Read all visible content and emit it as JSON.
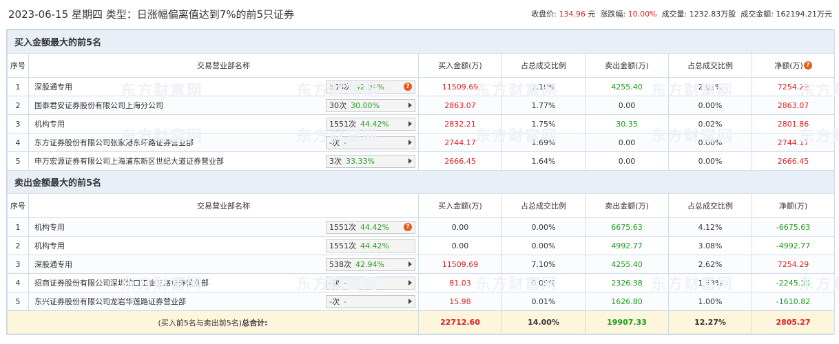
{
  "header": {
    "title": "2023-06-15 星期四 类型：日涨幅偏离值达到7%的前5只证券",
    "close_label": "收盘价:",
    "close_value": "134.96",
    "close_unit": "元",
    "change_label": "涨跌幅:",
    "change_value": "10.00%",
    "volume_label": "成交量:",
    "volume_value": "1232.83万股",
    "amount_label": "成交金额:",
    "amount_value": "162194.21万元"
  },
  "columns": {
    "idx": "序号",
    "name": "交易营业部名称",
    "buy": "买入金额(万)",
    "buy_ratio": "占总成交比例",
    "sell": "卖出金额(万)",
    "sell_ratio": "占总成交比例",
    "net": "净额(万)"
  },
  "buy_section": {
    "title": "买入金额最大的前5名",
    "rows": [
      {
        "idx": "1",
        "name": "深股通专用",
        "count": "538次",
        "pct": "42.94%",
        "icon": "question-icon",
        "buy": "11509.69",
        "buy_ratio": "7.10%",
        "sell": "4255.40",
        "sell_ratio": "2.62%",
        "net": "7254.29"
      },
      {
        "idx": "2",
        "name": "国泰君安证券股份有限公司上海分公司",
        "count": "30次",
        "pct": "30.00%",
        "icon": "arrow-right-icon",
        "buy": "2863.07",
        "buy_ratio": "1.77%",
        "sell": "0.00",
        "sell_ratio": "0.00%",
        "net": "2863.07"
      },
      {
        "idx": "3",
        "name": "机构专用",
        "count": "1551次",
        "pct": "44.42%",
        "icon": "arrow-right-icon",
        "buy": "2832.21",
        "buy_ratio": "1.75%",
        "sell": "30.35",
        "sell_ratio": "0.02%",
        "net": "2801.86"
      },
      {
        "idx": "4",
        "name": "东方证券股份有限公司张家港东环路证券营业部",
        "count": "-次",
        "pct": "-",
        "icon": "arrow-right-icon",
        "buy": "2744.17",
        "buy_ratio": "1.69%",
        "sell": "0.00",
        "sell_ratio": "0.00%",
        "net": "2744.17"
      },
      {
        "idx": "5",
        "name": "申万宏源证券有限公司上海浦东新区世纪大道证券营业部",
        "count": "3次",
        "pct": "33.33%",
        "icon": "arrow-right-icon",
        "buy": "2666.45",
        "buy_ratio": "1.64%",
        "sell": "0.00",
        "sell_ratio": "0.00%",
        "net": "2666.45"
      }
    ]
  },
  "sell_section": {
    "title": "卖出金额最大的前5名",
    "rows": [
      {
        "idx": "1",
        "name": "机构专用",
        "count": "1551次",
        "pct": "44.42%",
        "icon": "question-icon",
        "buy": "0.00",
        "buy_ratio": "0.00%",
        "sell": "6675.63",
        "sell_ratio": "4.12%",
        "net": "-6675.63"
      },
      {
        "idx": "2",
        "name": "机构专用",
        "count": "1551次",
        "pct": "44.42%",
        "icon": "none",
        "buy": "0.00",
        "buy_ratio": "0.00%",
        "sell": "4992.77",
        "sell_ratio": "3.08%",
        "net": "-4992.77"
      },
      {
        "idx": "3",
        "name": "深股通专用",
        "count": "538次",
        "pct": "42.94%",
        "icon": "arrow-right-icon",
        "buy": "11509.69",
        "buy_ratio": "7.10%",
        "sell": "4255.40",
        "sell_ratio": "2.62%",
        "net": "7254.29"
      },
      {
        "idx": "4",
        "name": "招商证券股份有限公司深圳蛇口工业三路证券营业部",
        "count": "-次",
        "pct": "-",
        "icon": "arrow-right-icon",
        "buy": "81.03",
        "buy_ratio": "0.05%",
        "sell": "2326.38",
        "sell_ratio": "1.43%",
        "net": "-2245.35"
      },
      {
        "idx": "5",
        "name": "东兴证券股份有限公司龙岩华莲路证券营业部",
        "count": "-次",
        "pct": "-",
        "icon": "arrow-right-icon",
        "buy": "15.98",
        "buy_ratio": "0.01%",
        "sell": "1626.80",
        "sell_ratio": "1.00%",
        "net": "-1610.82"
      }
    ]
  },
  "total": {
    "label_prefix": "(买入前5名与卖出前5名)",
    "label_bold": "总合计:",
    "buy": "22712.60",
    "buy_ratio": "14.00%",
    "sell": "19907.33",
    "sell_ratio": "12.27%",
    "net": "2805.27"
  },
  "watermark": "东方财富网",
  "colors": {
    "red": "#e02020",
    "green": "#1a9a1a",
    "accent": "#e85a1c"
  }
}
